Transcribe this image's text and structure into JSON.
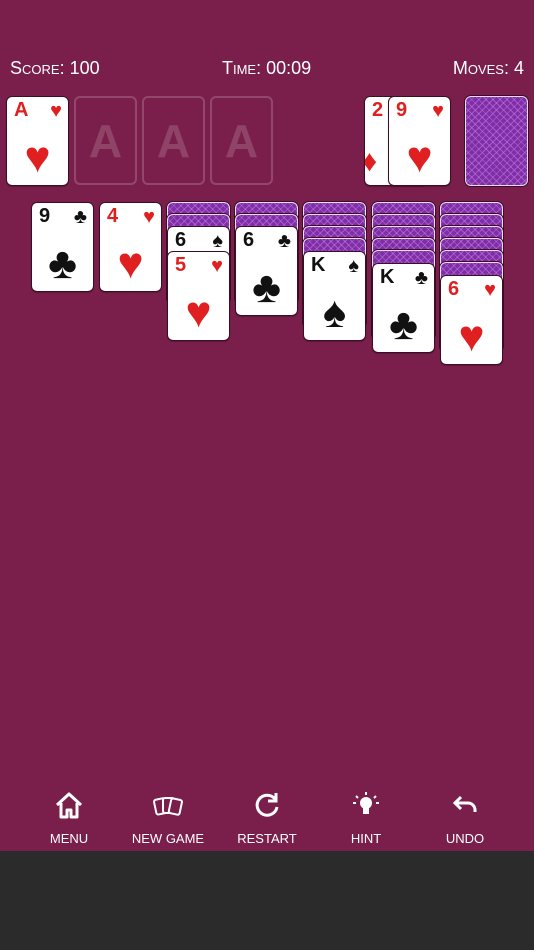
{
  "stats": {
    "score": "Score: 100",
    "time": "Time: 00:09",
    "moves": "Moves: 4"
  },
  "foundation": {
    "card1": {
      "rank": "A",
      "suit": "♥"
    },
    "placeholder_label": "A"
  },
  "waste": {
    "under_rank": "2",
    "under_suit": "♦",
    "top_rank": "9",
    "top_suit": "♥"
  },
  "tableau": {
    "col1": {
      "rank": "9",
      "suit": "♣"
    },
    "col2": {
      "rank": "4",
      "suit": "♥"
    },
    "col3_under": {
      "rank": "6",
      "suit": "♠"
    },
    "col3_top": {
      "rank": "5",
      "suit": "♥"
    },
    "col4": {
      "rank": "6",
      "suit": "♣"
    },
    "col5": {
      "rank": "K",
      "suit": "♠"
    },
    "col6": {
      "rank": "K",
      "suit": "♣"
    },
    "col7": {
      "rank": "6",
      "suit": "♥"
    }
  },
  "toolbar": {
    "menu": "MENU",
    "new_game": "NEW GAME",
    "restart": "RESTART",
    "hint": "HINT",
    "undo": "UNDO"
  },
  "icons": {
    "menu": "home-icon",
    "new_game": "cards-icon",
    "restart": "restart-icon",
    "hint": "lightbulb-icon",
    "undo": "undo-icon"
  },
  "colors": {
    "background": "#7a1f4b",
    "card_back": "#7e2fa6",
    "red_suit": "#e02020"
  }
}
